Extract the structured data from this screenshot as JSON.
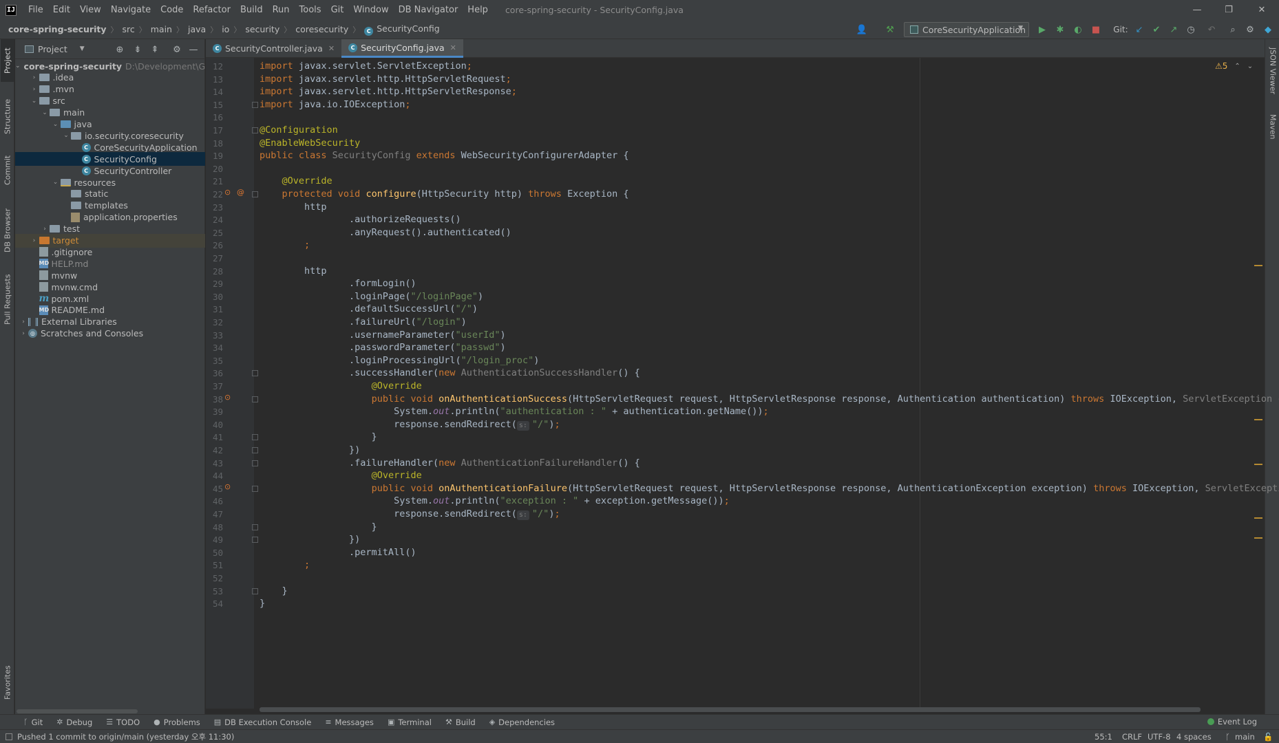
{
  "menubar": {
    "logo": "IJ",
    "items": [
      "File",
      "Edit",
      "View",
      "Navigate",
      "Code",
      "Refactor",
      "Build",
      "Run",
      "Tools",
      "Git",
      "Window",
      "DB Navigator",
      "Help"
    ],
    "title": "core-spring-security - SecurityConfig.java",
    "minimize": "—",
    "maximize": "❐",
    "close": "✕"
  },
  "breadcrumbs": [
    "core-spring-security",
    "src",
    "main",
    "java",
    "io",
    "security",
    "coresecurity",
    "SecurityConfig"
  ],
  "toolbar": {
    "run_config": "CoreSecurityApplication",
    "git_label": "Git:"
  },
  "left_strip": [
    "Project",
    "Structure",
    "Commit",
    "DB Browser",
    "Pull Requests",
    "Favorites"
  ],
  "right_strip": [
    "JSON Viewer",
    "Maven"
  ],
  "project": {
    "header": "Project",
    "root_name": "core-spring-security",
    "root_path": "D:\\Development\\G",
    "items": [
      {
        "label": ".idea",
        "depth": 1,
        "arrow": "›",
        "kind": "folder"
      },
      {
        "label": ".mvn",
        "depth": 1,
        "arrow": "›",
        "kind": "folder"
      },
      {
        "label": "src",
        "depth": 1,
        "arrow": "⌄",
        "kind": "folder"
      },
      {
        "label": "main",
        "depth": 2,
        "arrow": "⌄",
        "kind": "folder"
      },
      {
        "label": "java",
        "depth": 3,
        "arrow": "⌄",
        "kind": "folder-blue"
      },
      {
        "label": "io.security.coresecurity",
        "depth": 4,
        "arrow": "⌄",
        "kind": "folder"
      },
      {
        "label": "CoreSecurityApplication",
        "depth": 5,
        "arrow": "",
        "kind": "class"
      },
      {
        "label": "SecurityConfig",
        "depth": 5,
        "arrow": "",
        "kind": "class",
        "selected": true
      },
      {
        "label": "SecurityController",
        "depth": 5,
        "arrow": "",
        "kind": "class"
      },
      {
        "label": "resources",
        "depth": 3,
        "arrow": "⌄",
        "kind": "folder-res"
      },
      {
        "label": "static",
        "depth": 4,
        "arrow": "",
        "kind": "folder"
      },
      {
        "label": "templates",
        "depth": 4,
        "arrow": "",
        "kind": "folder"
      },
      {
        "label": "application.properties",
        "depth": 4,
        "arrow": "",
        "kind": "props"
      },
      {
        "label": "test",
        "depth": 2,
        "arrow": "›",
        "kind": "folder"
      },
      {
        "label": "target",
        "depth": 1,
        "arrow": "›",
        "kind": "folder-orange",
        "excluded": true
      },
      {
        "label": ".gitignore",
        "depth": 1,
        "arrow": "",
        "kind": "file"
      },
      {
        "label": "HELP.md",
        "depth": 1,
        "arrow": "",
        "kind": "md",
        "muted": true
      },
      {
        "label": "mvnw",
        "depth": 1,
        "arrow": "",
        "kind": "file"
      },
      {
        "label": "mvnw.cmd",
        "depth": 1,
        "arrow": "",
        "kind": "file"
      },
      {
        "label": "pom.xml",
        "depth": 1,
        "arrow": "",
        "kind": "maven"
      },
      {
        "label": "README.md",
        "depth": 1,
        "arrow": "",
        "kind": "md"
      },
      {
        "label": "External Libraries",
        "depth": 0,
        "arrow": "›",
        "kind": "lib"
      },
      {
        "label": "Scratches and Consoles",
        "depth": 0,
        "arrow": "›",
        "kind": "scratch"
      }
    ]
  },
  "tabs": [
    {
      "label": "SecurityController.java",
      "active": false
    },
    {
      "label": "SecurityConfig.java",
      "active": true
    }
  ],
  "editor": {
    "warnings": "⚠5",
    "first_line": 12,
    "lines": [
      [
        [
          "kw",
          "import "
        ],
        [
          "",
          "javax.servlet.ServletException"
        ],
        [
          "kw",
          ";"
        ]
      ],
      [
        [
          "kw",
          "import "
        ],
        [
          "",
          "javax.servlet.http.HttpServletRequest"
        ],
        [
          "kw",
          ";"
        ]
      ],
      [
        [
          "kw",
          "import "
        ],
        [
          "",
          "javax.servlet.http.HttpServletResponse"
        ],
        [
          "kw",
          ";"
        ]
      ],
      [
        [
          "kw",
          "import "
        ],
        [
          "",
          "java.io.IOException"
        ],
        [
          "kw",
          ";"
        ]
      ],
      [],
      [
        [
          "ann",
          "@Configuration"
        ]
      ],
      [
        [
          "ann",
          "@EnableWebSecurity"
        ]
      ],
      [
        [
          "kw",
          "public class "
        ],
        [
          "gray",
          "SecurityConfig "
        ],
        [
          "kw",
          "extends "
        ],
        [
          "",
          "WebSecurityConfigurerAdapter {"
        ]
      ],
      [],
      [
        [
          "",
          "    "
        ],
        [
          "ann",
          "@Override"
        ]
      ],
      [
        [
          "",
          "    "
        ],
        [
          "kw",
          "protected void "
        ],
        [
          "fn",
          "configure"
        ],
        [
          "",
          "(HttpSecurity http) "
        ],
        [
          "kw",
          "throws "
        ],
        [
          "",
          "Exception {"
        ]
      ],
      [
        [
          "",
          "        http"
        ]
      ],
      [
        [
          "",
          "                .authorizeRequests()"
        ]
      ],
      [
        [
          "",
          "                .anyRequest().authenticated()"
        ]
      ],
      [
        [
          "",
          "        "
        ],
        [
          "kw",
          ";"
        ]
      ],
      [],
      [
        [
          "",
          "        http"
        ]
      ],
      [
        [
          "",
          "                .formLogin()"
        ]
      ],
      [
        [
          "",
          "                .loginPage("
        ],
        [
          "str",
          "\"/loginPage\""
        ],
        [
          "",
          ")"
        ]
      ],
      [
        [
          "",
          "                .defaultSuccessUrl("
        ],
        [
          "str",
          "\"/\""
        ],
        [
          "",
          ")"
        ]
      ],
      [
        [
          "",
          "                .failureUrl("
        ],
        [
          "str",
          "\"/login\""
        ],
        [
          "",
          ")"
        ]
      ],
      [
        [
          "",
          "                .usernameParameter("
        ],
        [
          "str",
          "\"userId\""
        ],
        [
          "",
          ")"
        ]
      ],
      [
        [
          "",
          "                .passwordParameter("
        ],
        [
          "str",
          "\"passwd\""
        ],
        [
          "",
          ")"
        ]
      ],
      [
        [
          "",
          "                .loginProcessingUrl("
        ],
        [
          "str",
          "\"/login_proc\""
        ],
        [
          "",
          ")"
        ]
      ],
      [
        [
          "",
          "                .successHandler("
        ],
        [
          "kw",
          "new "
        ],
        [
          "gray",
          "AuthenticationSuccessHandler"
        ],
        [
          "",
          "() {"
        ]
      ],
      [
        [
          "",
          "                    "
        ],
        [
          "ann",
          "@Override"
        ]
      ],
      [
        [
          "",
          "                    "
        ],
        [
          "kw",
          "public void "
        ],
        [
          "fn",
          "onAuthenticationSuccess"
        ],
        [
          "",
          "(HttpServletRequest request, HttpServletResponse response, Authentication authentication) "
        ],
        [
          "kw",
          "throws "
        ],
        [
          "",
          "IOException, "
        ],
        [
          "gray",
          "ServletException {"
        ]
      ],
      [
        [
          "",
          "                        System."
        ],
        [
          "italic",
          "out"
        ],
        [
          "",
          ".println("
        ],
        [
          "str",
          "\"authentication : \" "
        ],
        [
          "",
          "+ authentication.getName())"
        ],
        [
          "kw",
          ";"
        ]
      ],
      [
        [
          "",
          "                        response.sendRedirect("
        ],
        [
          "hint",
          "s:"
        ],
        [
          "str",
          "\"/\""
        ],
        [
          "",
          ")"
        ],
        [
          "kw",
          ";"
        ]
      ],
      [
        [
          "",
          "                    }"
        ]
      ],
      [
        [
          "",
          "                })"
        ]
      ],
      [
        [
          "",
          "                .failureHandler("
        ],
        [
          "kw",
          "new "
        ],
        [
          "gray",
          "AuthenticationFailureHandler"
        ],
        [
          "",
          "() {"
        ]
      ],
      [
        [
          "",
          "                    "
        ],
        [
          "ann",
          "@Override"
        ]
      ],
      [
        [
          "",
          "                    "
        ],
        [
          "kw",
          "public void "
        ],
        [
          "fn",
          "onAuthenticationFailure"
        ],
        [
          "",
          "(HttpServletRequest request, HttpServletResponse response, AuthenticationException exception) "
        ],
        [
          "kw",
          "throws "
        ],
        [
          "",
          "IOException, "
        ],
        [
          "gray",
          "ServletException {"
        ]
      ],
      [
        [
          "",
          "                        System."
        ],
        [
          "italic",
          "out"
        ],
        [
          "",
          ".println("
        ],
        [
          "str",
          "\"exception : \" "
        ],
        [
          "",
          "+ exception.getMessage())"
        ],
        [
          "kw",
          ";"
        ]
      ],
      [
        [
          "",
          "                        response.sendRedirect("
        ],
        [
          "hint",
          "s:"
        ],
        [
          "str",
          "\"/\""
        ],
        [
          "",
          ")"
        ],
        [
          "kw",
          ";"
        ]
      ],
      [
        [
          "",
          "                    }"
        ]
      ],
      [
        [
          "",
          "                })"
        ]
      ],
      [
        [
          "",
          "                .permitAll()"
        ]
      ],
      [
        [
          "",
          "        "
        ],
        [
          "kw",
          ";"
        ]
      ],
      [],
      [
        [
          "",
          "    }"
        ]
      ],
      [
        [
          "",
          "}"
        ]
      ]
    ]
  },
  "bottom_tools": [
    {
      "icon": "ᚴ",
      "label": "Git"
    },
    {
      "icon": "✲",
      "label": "Debug"
    },
    {
      "icon": "☰",
      "label": "TODO"
    },
    {
      "icon": "●",
      "label": "Problems"
    },
    {
      "icon": "▤",
      "label": "DB Execution Console"
    },
    {
      "icon": "≡",
      "label": "Messages"
    },
    {
      "icon": "▣",
      "label": "Terminal"
    },
    {
      "icon": "⚒",
      "label": "Build"
    },
    {
      "icon": "◈",
      "label": "Dependencies"
    }
  ],
  "event_log": "Event Log",
  "status": {
    "message": "Pushed 1 commit to origin/main (yesterday 오후 11:30)",
    "position": "55:1",
    "line_sep": "CRLF",
    "encoding": "UTF-8",
    "indent": "4 spaces",
    "branch": "main"
  },
  "colors": {
    "accent": "#4a88c7",
    "selection": "#0d293e",
    "keyword": "#cc7832",
    "annotation": "#bbb529",
    "string": "#6a8759",
    "function": "#ffc66d"
  }
}
